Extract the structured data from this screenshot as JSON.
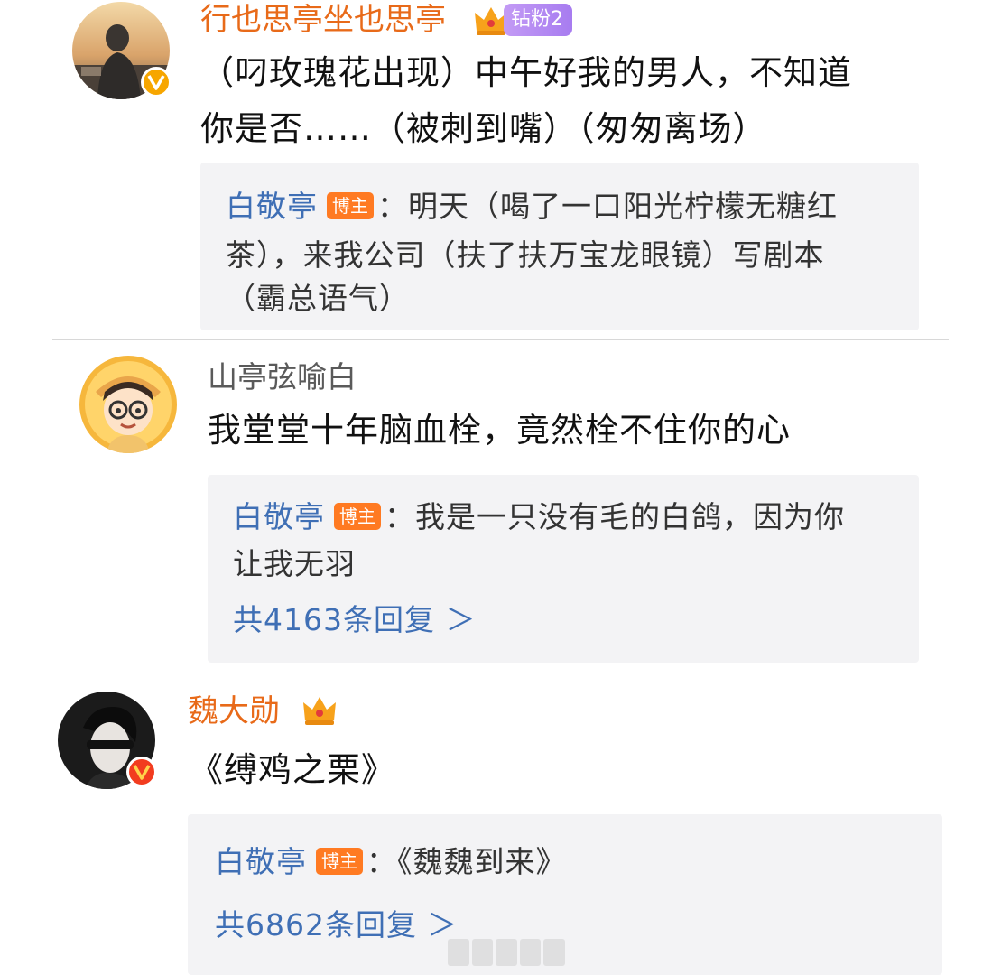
{
  "comments": [
    {
      "username": "行也思亭坐也思亭",
      "fan_badge": "钻粉2",
      "text_lines": [
        "（叼玫瑰花出现）中午好我的男人，不知道",
        "你是否……（被刺到嘴）（匆匆离场）"
      ],
      "reply": {
        "blogger": "白敬亭",
        "tag": "博主",
        "first": "：明天（喝了一口阳光柠檬无糖红",
        "lines": [
          "茶），来我公司（扶了扶万宝龙眼镜）写剧本",
          "（霸总语气）"
        ]
      }
    },
    {
      "username": "山亭弦喻白",
      "text_lines": [
        "我堂堂十年脑血栓，竟然栓不住你的心"
      ],
      "reply": {
        "blogger": "白敬亭",
        "tag": "博主",
        "first": "：我是一只没有毛的白鸽，因为你",
        "lines": [
          "让我无羽"
        ],
        "total": "共4163条回复 ＞"
      }
    },
    {
      "username": "魏大勋",
      "text_lines": [
        "《缚鸡之栗》"
      ],
      "reply": {
        "blogger": "白敬亭",
        "tag": "博主",
        "first": "：《魏魏到来》",
        "total": "共6862条回复 ＞"
      }
    }
  ],
  "colors": {
    "username_highlight": "#e86a19",
    "username_normal": "#5a5a5a",
    "blogger_link": "#3f6fb5",
    "blogger_tag": "#ff7a22",
    "fan_badge": "#a77cf0",
    "reply_bg": "#f3f3f5",
    "verified_yellow": "#f7a600",
    "verified_red": "#f23c1f"
  },
  "icons": [
    "crown-icon",
    "verified-badge-icon",
    "chevron-right-icon"
  ]
}
